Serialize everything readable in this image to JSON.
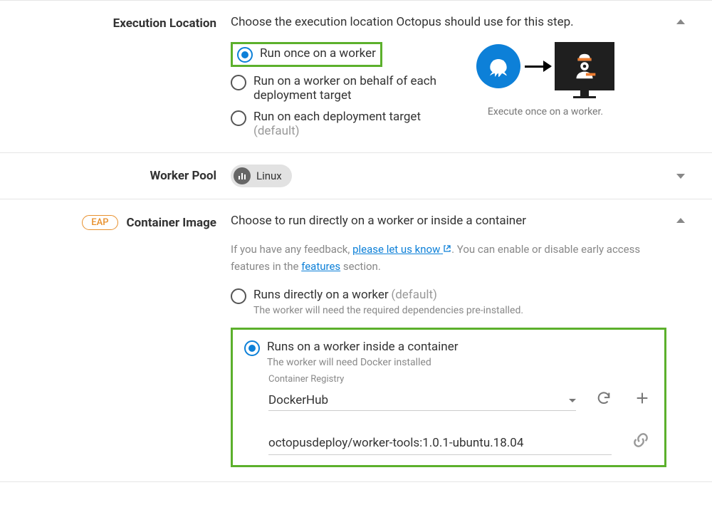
{
  "execution": {
    "label": "Execution Location",
    "description": "Choose the execution location Octopus should use for this step.",
    "options": {
      "onceOnWorker": "Run once on a worker",
      "perTarget": "Run on a worker on behalf of each deployment target",
      "onTarget": "Run on each deployment target"
    },
    "defaultTag": "(default)",
    "graphicCaption": "Execute once on a worker."
  },
  "workerPool": {
    "label": "Worker Pool",
    "chip": "Linux"
  },
  "container": {
    "eap": "EAP",
    "label": "Container Image",
    "description": "Choose to run directly on a worker or inside a container",
    "feedbackPrefix": "If you have any feedback, ",
    "feedbackLink": "please let us know",
    "feedbackMid": ". You can enable or disable early access features in the ",
    "featuresLink": "features",
    "feedbackSuffix": " section.",
    "options": {
      "direct": "Runs directly on a worker",
      "directHelp": "The worker will need the required dependencies pre-installed.",
      "inside": "Runs on a worker inside a container",
      "insideHelp": "The worker will need Docker installed"
    },
    "registryLabel": "Container Registry",
    "registryValue": "DockerHub",
    "imageValue": "octopusdeploy/worker-tools:1.0.1-ubuntu.18.04",
    "defaultTag": "(default)"
  }
}
